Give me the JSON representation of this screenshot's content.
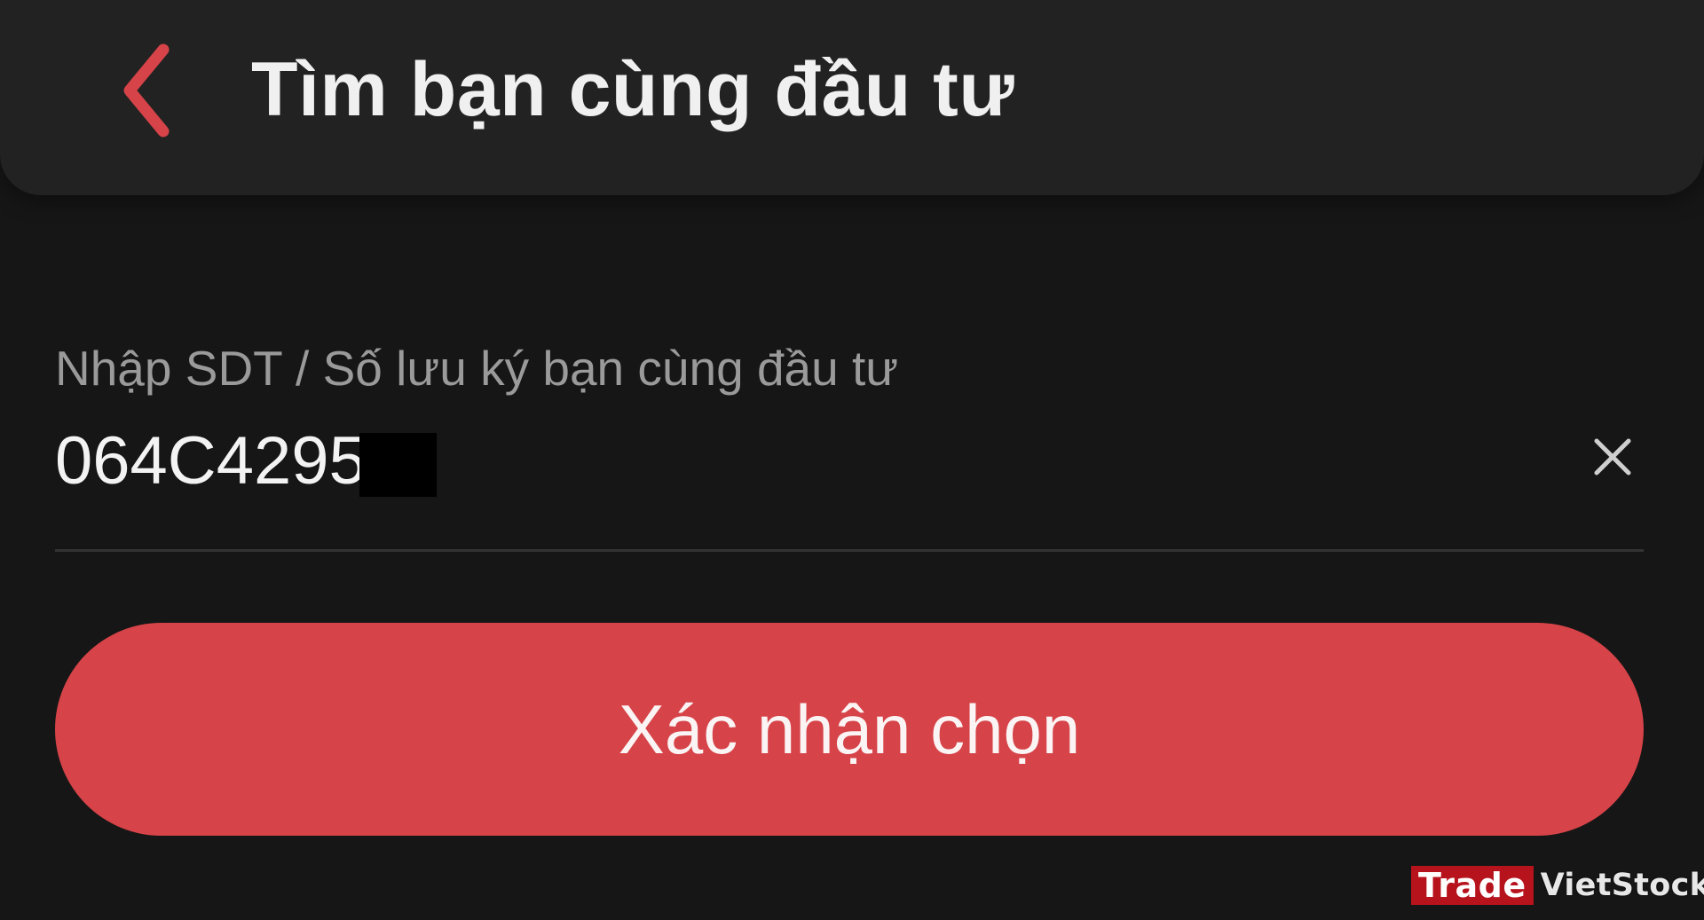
{
  "header": {
    "title": "Tìm bạn cùng đầu tư",
    "back_icon": "chevron-left-icon"
  },
  "form": {
    "label": "Nhập SDT / Số lưu ký bạn cùng đầu tư",
    "value": "064C4295",
    "clear_icon": "close-icon",
    "redacted": true
  },
  "actions": {
    "confirm_label": "Xác nhận chọn"
  },
  "watermark": {
    "trade": "Trade",
    "brand": "VietStock"
  },
  "colors": {
    "background": "#161616",
    "header": "#222222",
    "accent": "#d64348",
    "text": "#f0f0f0",
    "label": "#9a9a9a"
  }
}
